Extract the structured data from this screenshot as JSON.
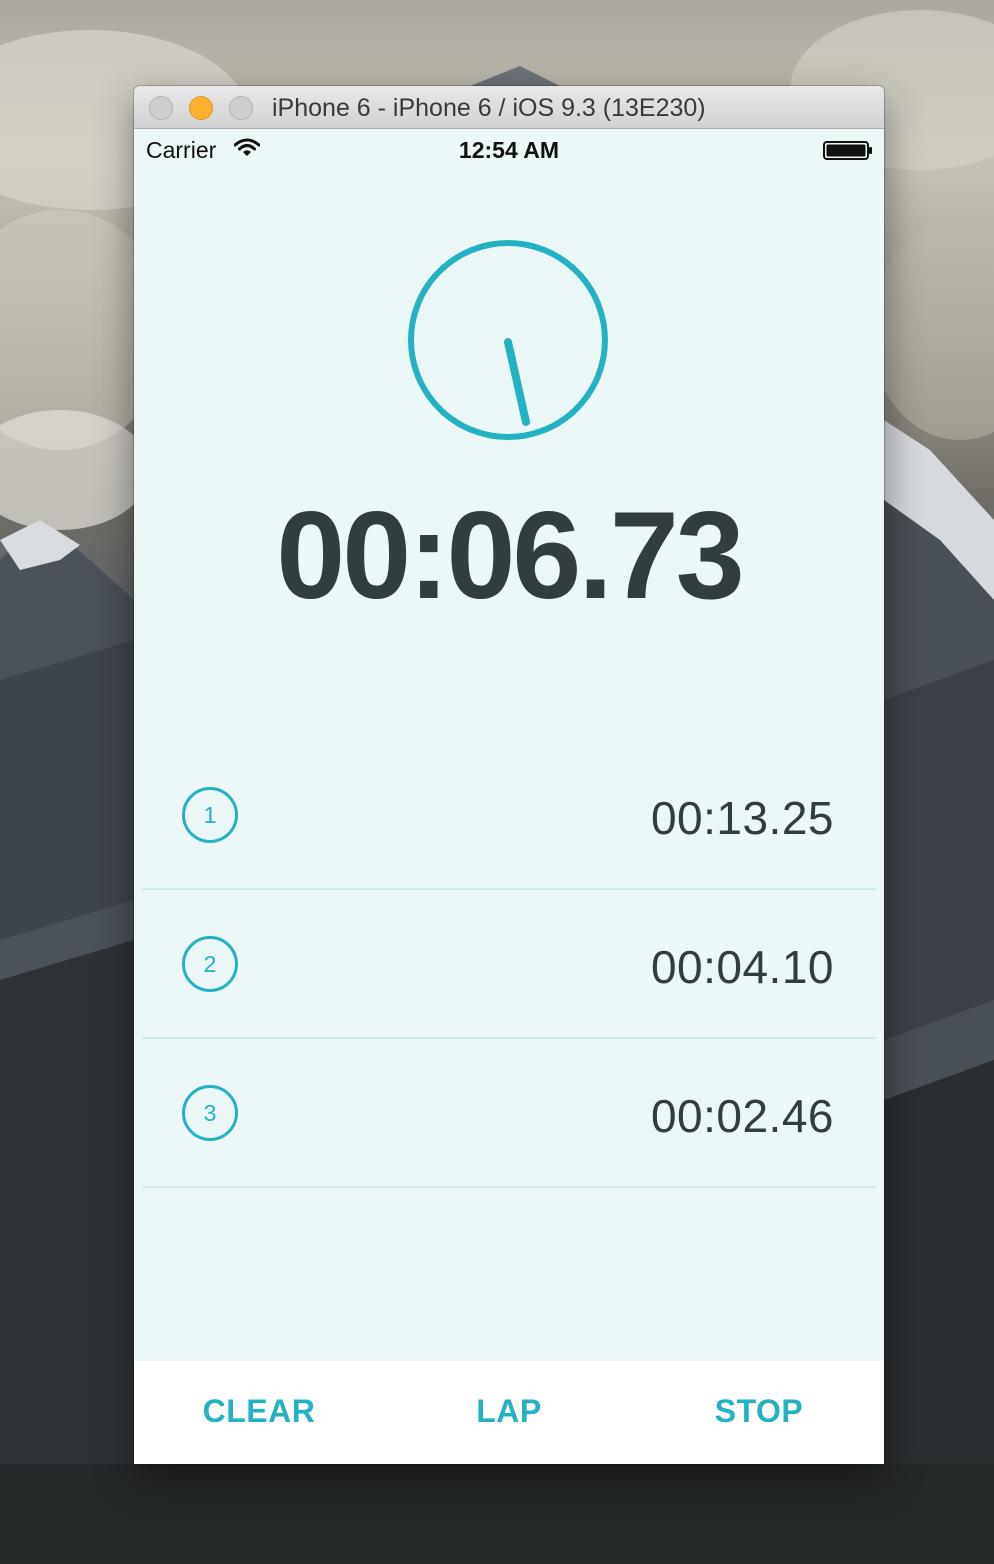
{
  "window": {
    "title": "iPhone 6 - iPhone 6 / iOS 9.3 (13E230)"
  },
  "status_bar": {
    "carrier": "Carrier",
    "time": "12:54 AM"
  },
  "stopwatch": {
    "elapsed": "00:06.73",
    "accent_color": "#23b1c4",
    "text_color": "#333d40"
  },
  "laps": [
    {
      "number": "1",
      "time": "00:13.25"
    },
    {
      "number": "2",
      "time": "00:04.10"
    },
    {
      "number": "3",
      "time": "00:02.46"
    }
  ],
  "actions": {
    "clear_label": "CLEAR",
    "lap_label": "LAP",
    "stop_label": "STOP"
  },
  "icons": {
    "wifi": "wifi-icon",
    "battery": "battery-icon"
  }
}
